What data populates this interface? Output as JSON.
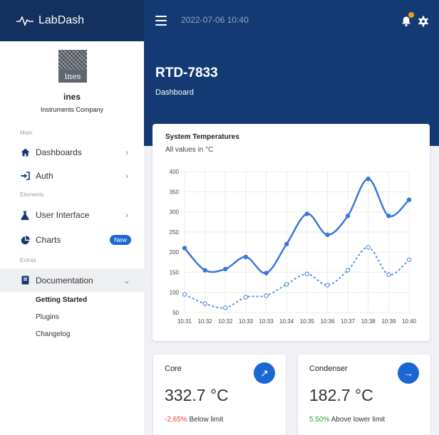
{
  "app": {
    "name": "LabDash",
    "datetime": "2022-07-06 10:40"
  },
  "user": {
    "name": "ines",
    "company": "Instruments Company",
    "avatar_text": "ines"
  },
  "sidebar": {
    "sections": [
      "Main",
      "Elements",
      "Extras"
    ],
    "items": [
      {
        "label": "Dashboards",
        "icon": "home-icon"
      },
      {
        "label": "Auth",
        "icon": "sign-in-icon"
      },
      {
        "label": "User Interface",
        "icon": "flask-icon"
      },
      {
        "label": "Charts",
        "icon": "pie-chart-icon",
        "badge": "New"
      },
      {
        "label": "Documentation",
        "icon": "book-icon"
      }
    ],
    "sub_items": [
      "Getting Started",
      "Plugins",
      "Changelog"
    ]
  },
  "page": {
    "title": "RTD-7833",
    "subtitle": "Dashboard"
  },
  "chart_data": {
    "type": "line",
    "title": "System Temperatures",
    "subtitle": "All values in °C",
    "categories": [
      "10:31",
      "10:32",
      "10:32",
      "10:33",
      "10:33",
      "10:34",
      "10:35",
      "10:36",
      "10:37",
      "10:38",
      "10:39",
      "10:40"
    ],
    "ylim": [
      50,
      400
    ],
    "yticks": [
      50,
      100,
      150,
      200,
      250,
      300,
      350,
      400
    ],
    "grid": true,
    "series": [
      {
        "values": [
          210,
          155,
          158,
          188,
          148,
          220,
          295,
          243,
          290,
          382,
          290,
          330
        ],
        "style": "solid",
        "color": "#3a78d8"
      },
      {
        "values": [
          95,
          72,
          62,
          88,
          92,
          120,
          146,
          118,
          155,
          212,
          144,
          181
        ],
        "style": "dotted",
        "color": "#5a90e0"
      }
    ]
  },
  "stats": [
    {
      "title": "Core",
      "value": "332.7 °C",
      "delta": "-2.65%",
      "delta_text": "Below limit",
      "button_icon": "arrow-up-right-icon"
    },
    {
      "title": "Condenser",
      "value": "182.7 °C",
      "delta": "5.50%",
      "delta_text": "Above lower limit",
      "button_icon": "arrow-right-icon"
    }
  ],
  "colors": {
    "header": "#143a73",
    "brand": "#14305e",
    "accent": "#1a66d3",
    "notification": "#f39c12",
    "down": "#e53935",
    "up": "#2e9e44"
  }
}
